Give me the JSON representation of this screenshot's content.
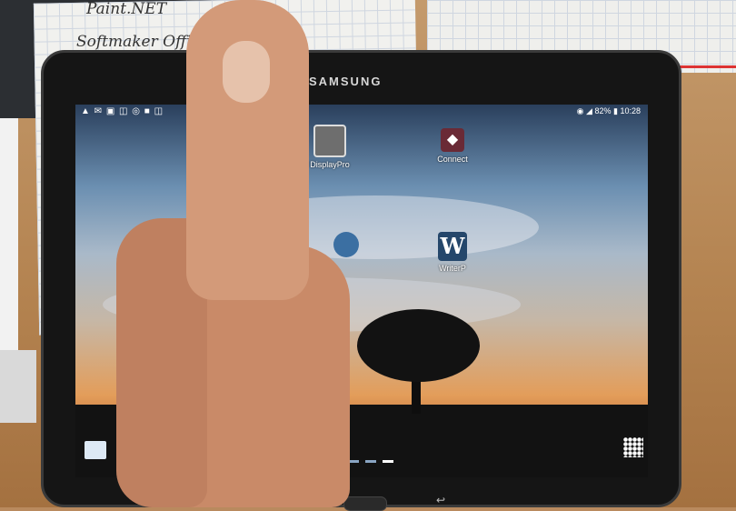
{
  "background": {
    "handwritten_notes": [
      "Paint.NET",
      "Softmaker Office"
    ]
  },
  "tablet": {
    "brand": "SAMSUNG",
    "status_bar": {
      "notification_icons": "▲ ✉ ▣ ◫ ◎ ■ ◫",
      "battery": "82%",
      "time": "10:28"
    },
    "home_screen": {
      "apps": [
        {
          "label": "DisplayPro",
          "icon": "displaypro-icon"
        },
        {
          "label": "Connect",
          "icon": "connect-icon"
        },
        {
          "label": "WriterP",
          "icon": "writer-icon"
        },
        {
          "label": "",
          "icon": "partially-hidden-app-icon"
        }
      ],
      "page_indicator": {
        "pages": 3,
        "active": 3
      }
    }
  },
  "colors": {
    "sky_top": "#2a3f5c",
    "sunset": "#e39d5a",
    "skin": "#d39a79"
  }
}
